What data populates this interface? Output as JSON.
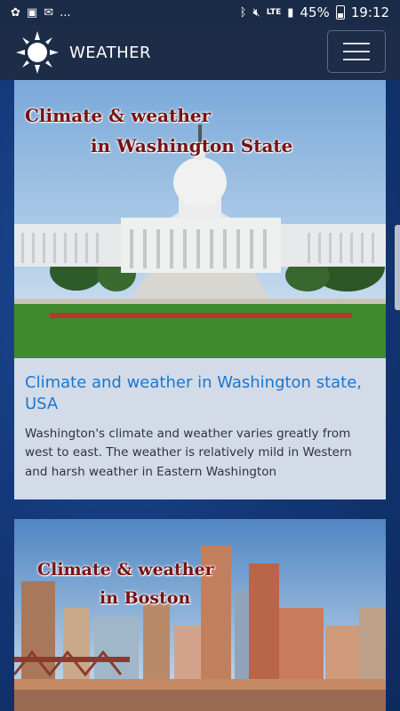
{
  "status": {
    "battery": "45%",
    "time": "19:12",
    "network": "LTE",
    "more": "..."
  },
  "app_bar": {
    "title": "WEATHER"
  },
  "cards": [
    {
      "image_caption_line1": "Climate & weather",
      "image_caption_line2": "in Washington State",
      "title": "Climate and weather in Washington state, USA",
      "description": "Washington's climate and weather varies greatly from west to east. The weather is relatively mild in Western and harsh weather in Eastern Washington"
    },
    {
      "image_caption_line1": "Climate & weather",
      "image_caption_line2": "in Boston"
    }
  ]
}
